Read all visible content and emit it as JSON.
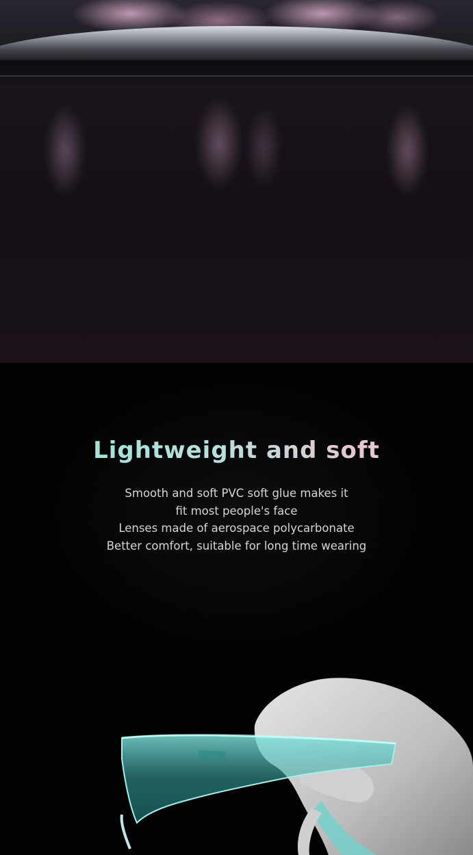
{
  "headline": "Lightweight and soft",
  "description_lines": [
    "Smooth and soft PVC soft glue makes it",
    "fit most people's face",
    "Lenses made of aerospace polycarbonate",
    "Better comfort, suitable for long time wearing"
  ],
  "colors": {
    "headline_gradient_start": "#8fe7d8",
    "headline_gradient_end": "#f2c8d6",
    "body_text": "#d6d6d6",
    "background": "#000000",
    "goggle_tint": "#5ec9c3"
  }
}
